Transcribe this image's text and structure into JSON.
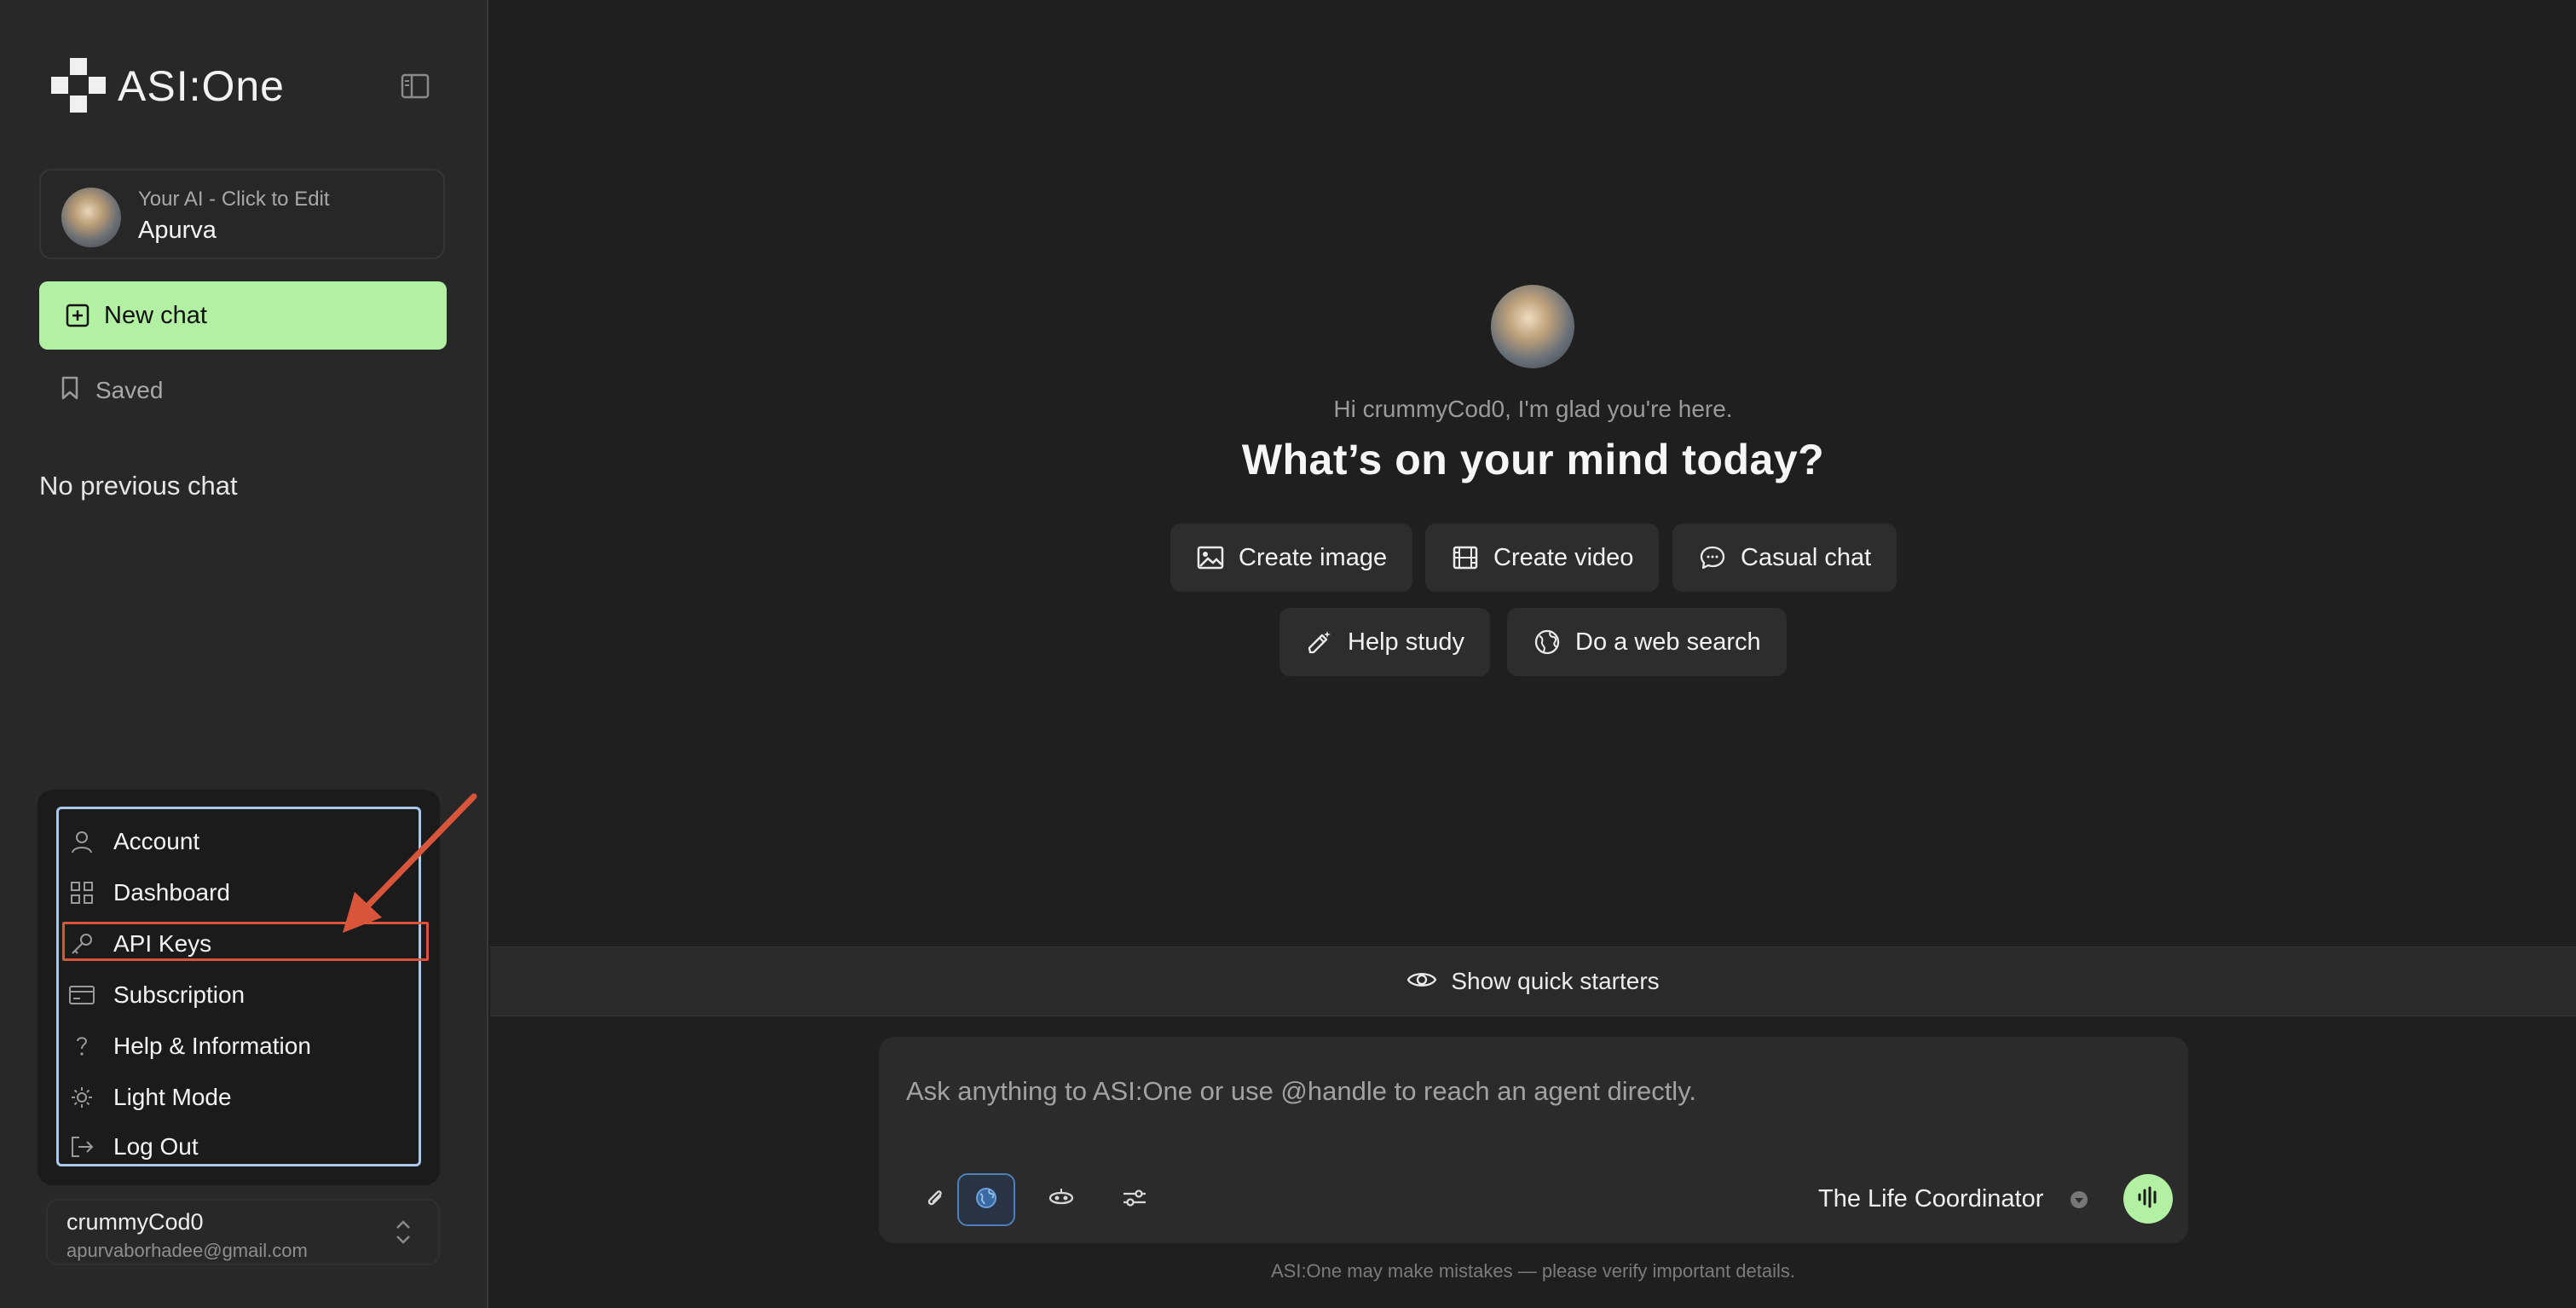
{
  "brand": {
    "name": "ASI:One"
  },
  "sidebar": {
    "profile": {
      "subtitle": "Your AI - Click to Edit",
      "name": "Apurva"
    },
    "new_chat_label": "New chat",
    "saved_label": "Saved",
    "empty_history": "No previous chat",
    "menu": {
      "items": [
        {
          "label": "Account",
          "icon": "user-icon"
        },
        {
          "label": "Dashboard",
          "icon": "grid-icon"
        },
        {
          "label": "API Keys",
          "icon": "key-icon"
        },
        {
          "label": "Subscription",
          "icon": "credit-card-icon"
        },
        {
          "label": "Help & Information",
          "icon": "question-icon"
        },
        {
          "label": "Light Mode",
          "icon": "sun-icon"
        },
        {
          "label": "Log Out",
          "icon": "logout-icon"
        }
      ],
      "highlighted_item": "API Keys",
      "annotation_color": "#d8553c"
    },
    "user": {
      "username": "crummyCod0",
      "email": "apurvaborhadee@gmail.com"
    }
  },
  "main": {
    "greeting": "Hi crummyCod0, I'm glad you're here.",
    "headline": "What’s on your mind today?",
    "starters": [
      {
        "label": "Create image",
        "icon": "image-icon"
      },
      {
        "label": "Create video",
        "icon": "film-icon"
      },
      {
        "label": "Casual chat",
        "icon": "chat-bubble-icon"
      },
      {
        "label": "Help study",
        "icon": "magic-pencil-icon"
      },
      {
        "label": "Do a web search",
        "icon": "globe-icon"
      }
    ],
    "quick_starters_label": "Show quick starters",
    "composer": {
      "placeholder": "Ask anything to ASI:One or use @handle to reach an agent directly.",
      "agent_name": "The Life Coordinator"
    },
    "disclaimer": "ASI:One may make mistakes — please verify important details."
  },
  "colors": {
    "accent_green": "#b2f0a4",
    "menu_border": "#a9c9ec",
    "background": "#1f1f1f",
    "sidebar": "#282828"
  }
}
